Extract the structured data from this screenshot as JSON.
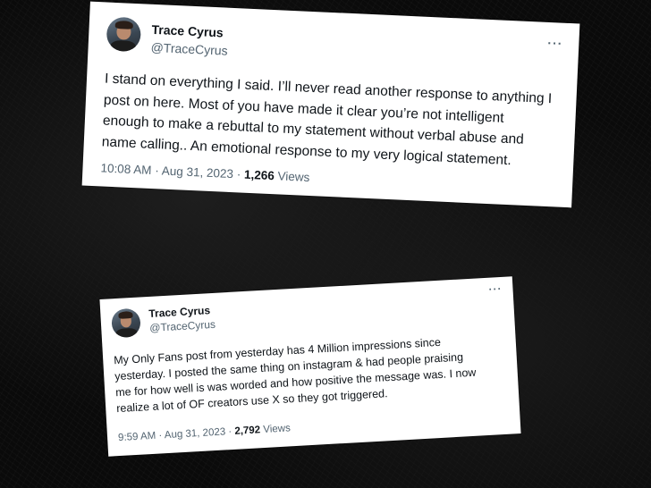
{
  "tweets": [
    {
      "name": "Trace Cyrus",
      "handle": "@TraceCyrus",
      "more": "···",
      "text": "I  stand on everything I said. I’ll never read another response to anything I\npost on here. Most of you have made it clear you’re not intelligent\nenough to make a rebuttal to my statement without verbal abuse and\nname calling.. An emotional response to my very logical statement.",
      "time": "10:08 AM",
      "date": "Aug 31, 2023",
      "views_count": "1,266",
      "views_label": "Views"
    },
    {
      "name": "Trace Cyrus",
      "handle": "@TraceCyrus",
      "more": "···",
      "text": "My Only Fans post from yesterday has 4 Million impressions since\nyesterday. I posted the same thing on instagram & had people praising\nme for how well is was worded and how positive the message was. I now\nrealize a lot of OF creators use X so they got triggered.",
      "time": "9:59 AM",
      "date": "Aug 31, 2023",
      "views_count": "2,792",
      "views_label": "Views"
    }
  ],
  "separator": "·"
}
